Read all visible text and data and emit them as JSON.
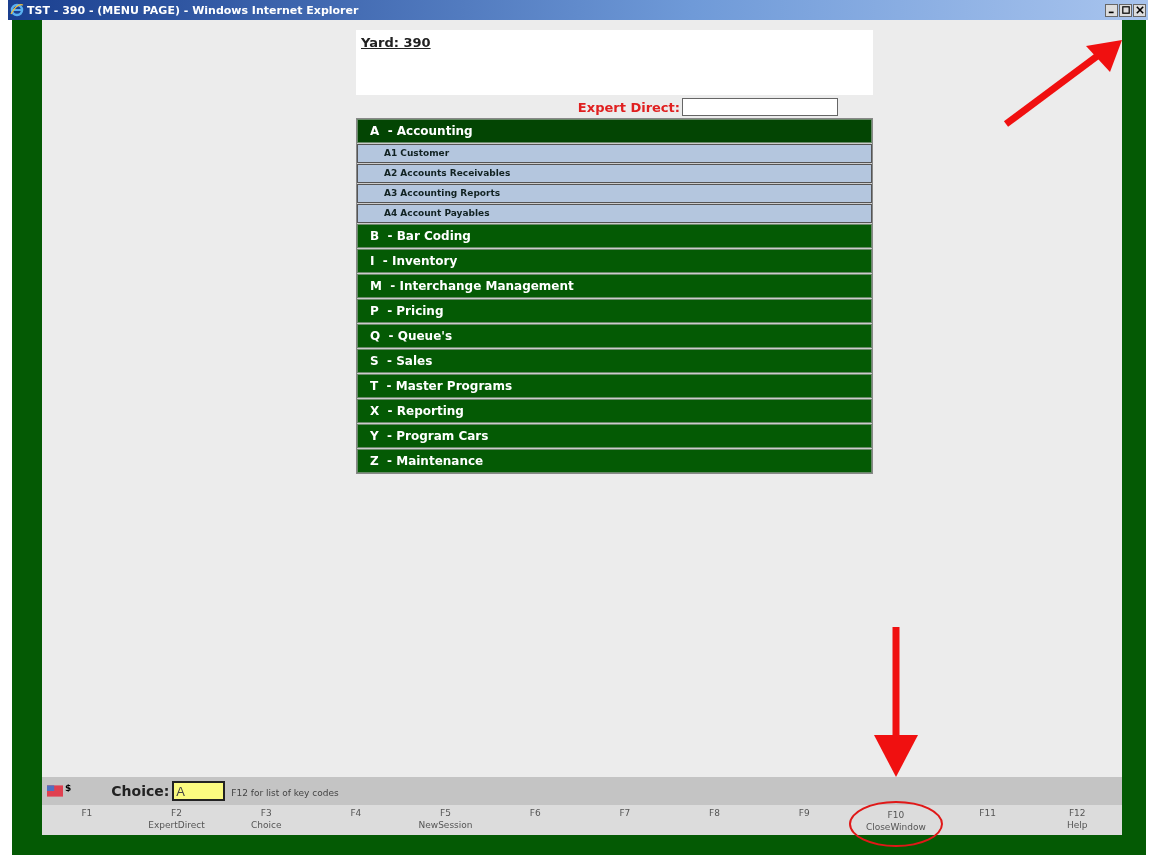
{
  "window": {
    "title": "TST - 390 - (MENU PAGE) - Windows Internet Explorer"
  },
  "yard": "Yard: 390",
  "expert_direct": {
    "label": "Expert Direct:"
  },
  "menu": [
    {
      "label": "A  - Accounting",
      "expanded": true,
      "children": [
        {
          "label": "A1 Customer"
        },
        {
          "label": "A2 Accounts Receivables"
        },
        {
          "label": "A3 Accounting Reports"
        },
        {
          "label": "A4 Account Payables"
        }
      ]
    },
    {
      "label": "B  - Bar Coding",
      "expanded": false
    },
    {
      "label": "I  - Inventory",
      "expanded": false
    },
    {
      "label": "M  - Interchange Management",
      "expanded": false
    },
    {
      "label": "P  - Pricing",
      "expanded": false
    },
    {
      "label": "Q  - Queue's",
      "expanded": false
    },
    {
      "label": "S  - Sales",
      "expanded": false
    },
    {
      "label": "T  - Master Programs",
      "expanded": false
    },
    {
      "label": "X  - Reporting",
      "expanded": false
    },
    {
      "label": "Y  - Program Cars",
      "expanded": false
    },
    {
      "label": "Z  - Maintenance",
      "expanded": false
    }
  ],
  "status": {
    "currency": "$",
    "choice_label": "Choice:",
    "choice_value": "A",
    "hint": "F12 for list of key codes"
  },
  "function_keys": [
    {
      "key": "F1"
    },
    {
      "key": "F2",
      "label": "ExpertDirect"
    },
    {
      "key": "F3",
      "label": "Choice"
    },
    {
      "key": "F4"
    },
    {
      "key": "F5",
      "label": "NewSession"
    },
    {
      "key": "F6"
    },
    {
      "key": "F7"
    },
    {
      "key": "F8"
    },
    {
      "key": "F9"
    },
    {
      "key": "F10",
      "label": "CloseWindow",
      "highlighted": true
    },
    {
      "key": "F11"
    },
    {
      "key": "F12",
      "label": "Help"
    }
  ]
}
